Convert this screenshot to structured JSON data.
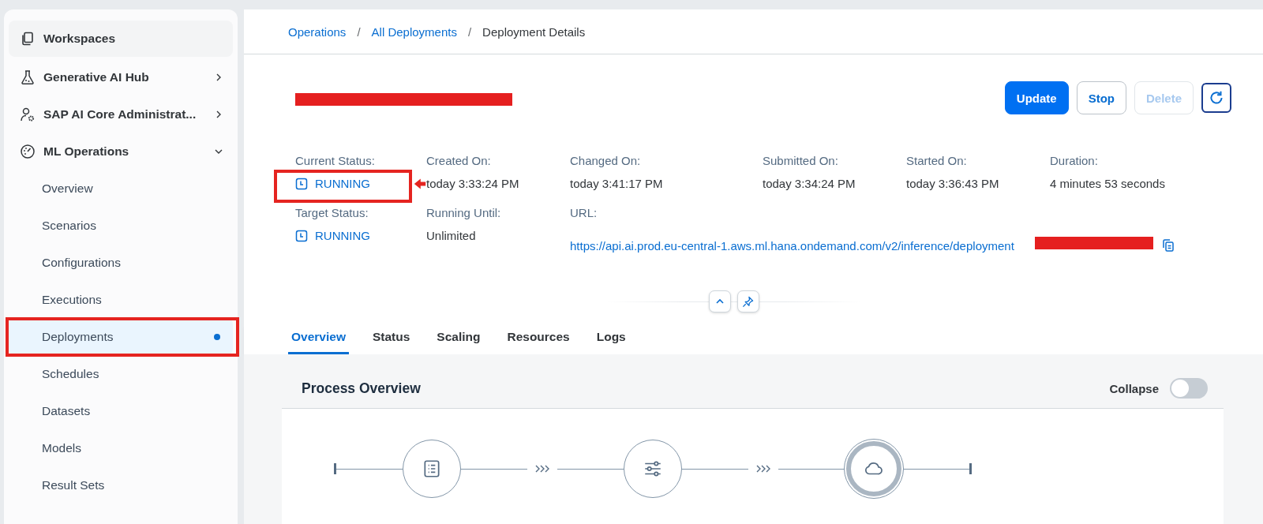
{
  "sidebar": {
    "items": [
      {
        "label": "Workspaces",
        "kind": "link",
        "hovered": true
      },
      {
        "label": "Generative AI Hub",
        "kind": "group",
        "expanded": false,
        "hovered": false
      },
      {
        "label": "SAP AI Core Administrat...",
        "kind": "group",
        "expanded": false,
        "hovered": false
      },
      {
        "label": "ML Operations",
        "kind": "group",
        "expanded": true,
        "hovered": false,
        "children": [
          {
            "label": "Overview",
            "selected": false,
            "annotated": false
          },
          {
            "label": "Scenarios",
            "selected": false,
            "annotated": false
          },
          {
            "label": "Configurations",
            "selected": false,
            "annotated": false
          },
          {
            "label": "Executions",
            "selected": false,
            "annotated": false
          },
          {
            "label": "Deployments",
            "selected": true,
            "annotated": true
          },
          {
            "label": "Schedules",
            "selected": false,
            "annotated": false
          },
          {
            "label": "Datasets",
            "selected": false,
            "annotated": false
          },
          {
            "label": "Models",
            "selected": false,
            "annotated": false
          },
          {
            "label": "Result Sets",
            "selected": false,
            "annotated": false
          }
        ]
      }
    ]
  },
  "breadcrumb": {
    "separator": "/",
    "items": [
      {
        "label": "Operations",
        "kind": "link"
      },
      {
        "label": "All Deployments",
        "kind": "link"
      },
      {
        "label": "Deployment Details",
        "kind": "current"
      }
    ]
  },
  "header": {
    "title": {
      "redacted": true
    },
    "actions": [
      {
        "label": "Update",
        "kind": "primary",
        "disabled": false
      },
      {
        "label": "Stop",
        "kind": "default",
        "disabled": false
      },
      {
        "label": "Delete",
        "kind": "default",
        "disabled": true
      }
    ],
    "refresh": {
      "kind": "refresh"
    }
  },
  "details": [
    {
      "label": "Current Status:",
      "value": "RUNNING",
      "kind": "status",
      "annotated": true
    },
    {
      "label": "Created On:",
      "value": "today 3:33:24 PM",
      "kind": "text"
    },
    {
      "label": "Changed On:",
      "value": "today 3:41:17 PM",
      "kind": "text"
    },
    {
      "label": "Submitted On:",
      "value": "today 3:34:24 PM",
      "kind": "text"
    },
    {
      "label": "Started On:",
      "value": "today 3:36:43 PM",
      "kind": "text"
    },
    {
      "label": "Duration:",
      "value": "4 minutes 53 seconds",
      "kind": "text"
    },
    {
      "label": "Target Status:",
      "value": "RUNNING",
      "kind": "status",
      "annotated": false
    },
    {
      "label": "Running Until:",
      "value": "Unlimited",
      "kind": "text"
    },
    {
      "label": "URL:",
      "value": "https://api.ai.prod.eu-central-1.aws.ml.hana.ondemand.com/v2/inference/deployment",
      "kind": "link",
      "redacted": true
    }
  ],
  "tabs": [
    {
      "label": "Overview",
      "selected": true
    },
    {
      "label": "Status",
      "selected": false
    },
    {
      "label": "Scaling",
      "selected": false
    },
    {
      "label": "Resources",
      "selected": false
    },
    {
      "label": "Logs",
      "selected": false
    }
  ],
  "process": {
    "title": "Process Overview",
    "collapse_label": "Collapse",
    "collapse_on": false,
    "nodes": [
      {
        "kind": "execution",
        "current": false
      },
      {
        "kind": "configuration",
        "current": false
      },
      {
        "kind": "deployment",
        "current": true
      }
    ]
  }
}
